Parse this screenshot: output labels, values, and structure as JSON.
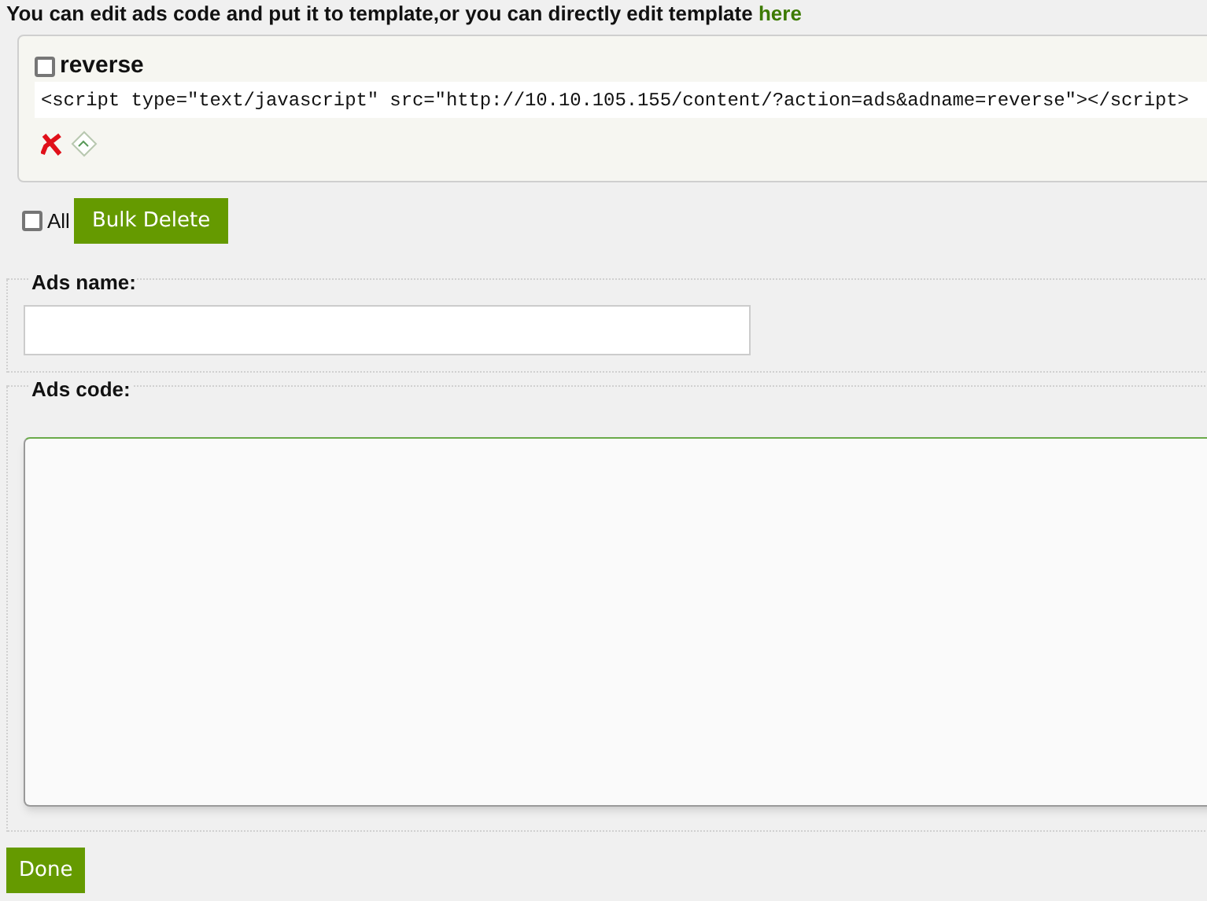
{
  "intro": {
    "text": "You can edit ads code and put it to template,or you can directly edit template",
    "link": "here"
  },
  "ads": [
    {
      "name": "reverse",
      "checked": false,
      "code": "<script type=\"text/javascript\" src=\"http://10.10.105.155/content/?action=ads&adname=reverse\"></script>"
    }
  ],
  "bulk": {
    "all_label": "All",
    "all_checked": false,
    "button": "Bulk Delete"
  },
  "form": {
    "name_label": "Ads name:",
    "code_label": "Ads code:",
    "submit": "Done"
  }
}
